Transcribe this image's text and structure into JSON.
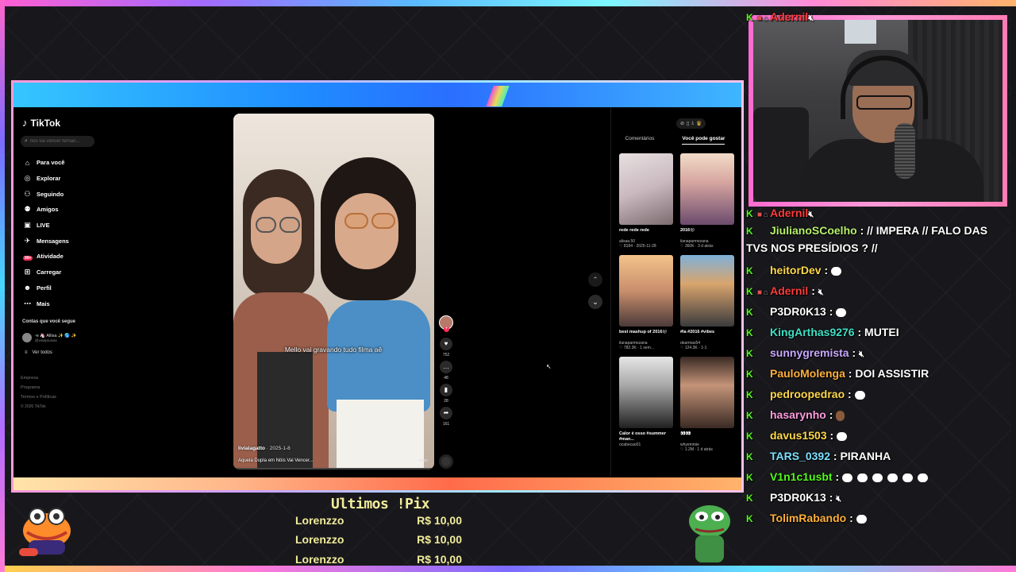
{
  "tiktok": {
    "logo": "TikTok",
    "search_placeholder": "nós vai vencer fernan...",
    "nav": [
      {
        "label": "Para você",
        "icon": "home-icon"
      },
      {
        "label": "Explorar",
        "icon": "compass-icon"
      },
      {
        "label": "Seguindo",
        "icon": "following-icon"
      },
      {
        "label": "Amigos",
        "icon": "friends-icon"
      },
      {
        "label": "LIVE",
        "icon": "live-icon"
      },
      {
        "label": "Mensagens",
        "icon": "messages-icon"
      },
      {
        "label": "Atividade",
        "icon": "activity-icon",
        "badge": "99+"
      },
      {
        "label": "Carregar",
        "icon": "upload-icon"
      },
      {
        "label": "Perfil",
        "icon": "profile-icon"
      },
      {
        "label": "Mais",
        "icon": "more-icon"
      }
    ],
    "following_title": "Contas que você segue",
    "following_account": "ꞏe 🦄 Allisa ✨ 🌎 ✨",
    "following_handle": "@voteprussia",
    "see_all": "Ver todos",
    "footer": [
      "Empresa",
      "Programa",
      "Termos e Políticas"
    ],
    "copyright": "© 2026 TikTok",
    "video": {
      "caption": "Mello vai gravando tudo filma aê",
      "author": "livialagatto",
      "date": "· 2025-1-8",
      "description": "Aquela Dupla em Nóis Vai Vencer...",
      "more": "mais"
    },
    "rail": {
      "likes": "752",
      "comments": "48",
      "saves": "28",
      "shares": "161"
    },
    "tabs": {
      "comments": "Comentários",
      "recommended": "Você pode gostar"
    },
    "cards": [
      {
        "title": "rede rede rede",
        "user": "alisaa.50",
        "meta": "♡ 8184 · 2025-11-28"
      },
      {
        "title": "2016😝",
        "user": "ilanaparmezana",
        "meta": "♡ 360K · 3 d atrás"
      },
      {
        "title": "best mashup of 2016😜",
        "user": "ilanaparmezana",
        "meta": "♡ 782.3K · 1 sem..."
      },
      {
        "title": "#la #2016 #vibes",
        "user": "dearmas54",
        "meta": "♡ 124.3K · 1-1"
      },
      {
        "title": "Calor é osso #summer #man...",
        "user": "ocabecao01",
        "meta": ""
      },
      {
        "title": "👀👀",
        "user": "whyemmie",
        "meta": "♡ 1.2M · 1 d atrás"
      }
    ]
  },
  "chat": [
    {
      "user": "Adernil",
      "color": "#ff3b3b",
      "badge": true,
      "text": "",
      "icon": "mute"
    },
    {
      "user": "Adernil",
      "color": "#ff3b3b",
      "badge": true,
      "text": "",
      "icon": "mute"
    },
    {
      "user": "JiulianoSCoelho",
      "color": "#b7f06a",
      "badge": false,
      "text": " : // IMPERA // FALO DAS TVS NOS PRESÍDIOS ? //",
      "icon": ""
    },
    {
      "user": "heitorDev",
      "color": "#ffd84a",
      "badge": false,
      "text": " : ",
      "icon": "emote"
    },
    {
      "user": "Adernil",
      "color": "#ff3b3b",
      "badge": true,
      "text": " : ",
      "icon": "mute"
    },
    {
      "user": "P3DR0K13",
      "color": "#ffffff",
      "badge": false,
      "text": " : ",
      "icon": "emote"
    },
    {
      "user": "KingArthas9276",
      "color": "#3fe0c5",
      "badge": false,
      "text": " : MUTEI",
      "icon": ""
    },
    {
      "user": "sunnygremista",
      "color": "#c9a7ff",
      "badge": false,
      "text": " : ",
      "icon": "mute"
    },
    {
      "user": "PauloMolenga",
      "color": "#ffb03b",
      "badge": false,
      "text": " : DOI ASSISTIR",
      "icon": ""
    },
    {
      "user": "pedroopedrao",
      "color": "#ffd84a",
      "badge": false,
      "text": " : ",
      "icon": "emote"
    },
    {
      "user": "hasarynho",
      "color": "#ff9de0",
      "badge": false,
      "text": " : ",
      "icon": "emote-brown"
    },
    {
      "user": "davus1503",
      "color": "#ffd84a",
      "badge": false,
      "text": " : ",
      "icon": "emote"
    },
    {
      "user": "TARS_0392",
      "color": "#7ce0ff",
      "badge": false,
      "text": " : PIRANHA",
      "icon": ""
    },
    {
      "user": "V1n1c1usbt",
      "color": "#53fc18",
      "badge": false,
      "text": " : ",
      "icon": "emote-x6"
    },
    {
      "user": "P3DR0K13",
      "color": "#ffffff",
      "badge": false,
      "text": " : ",
      "icon": "mute"
    },
    {
      "user": "TolimRabando",
      "color": "#ffb03b",
      "badge": false,
      "text": " : ",
      "icon": "emote"
    }
  ],
  "pix": {
    "title": "Ultimos !Pix",
    "rows": [
      {
        "name": "Lorenzzo",
        "amount": "R$ 10,00"
      },
      {
        "name": "Lorenzzo",
        "amount": "R$ 10,00"
      },
      {
        "name": "Lorenzzo",
        "amount": "R$ 10,00"
      }
    ]
  },
  "colors": {
    "accent": "#fe2c55",
    "chat_k": "#53fc18",
    "pix": "#f2ec9a"
  }
}
